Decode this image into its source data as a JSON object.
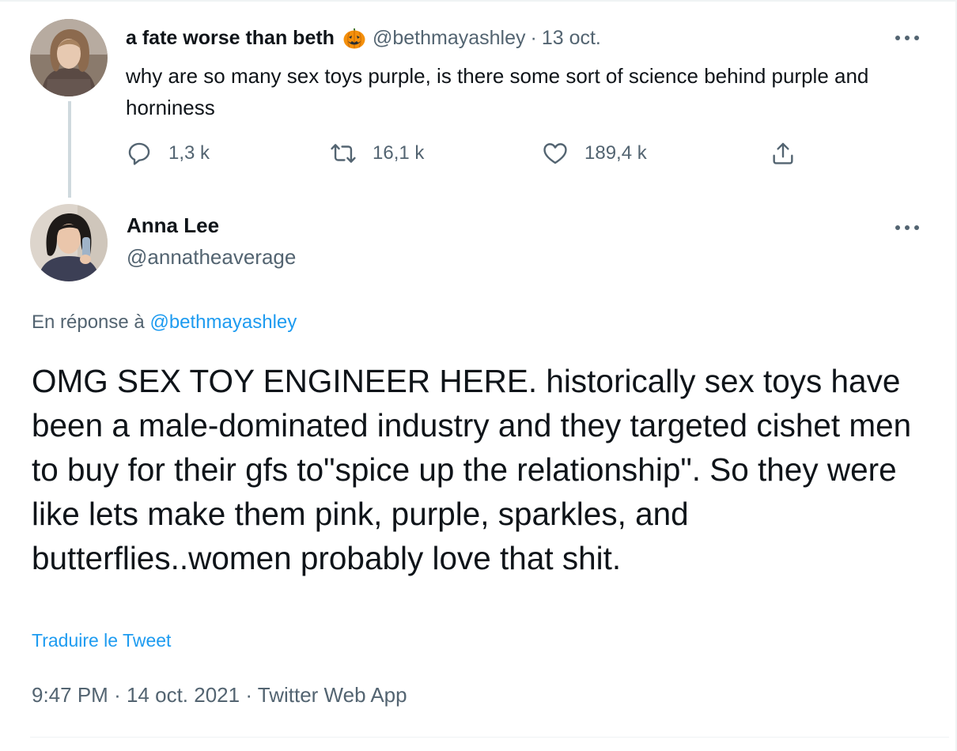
{
  "parent_tweet": {
    "display_name": "a fate worse than beth",
    "name_emoji": "pumpkin-emoji",
    "handle": "@bethmayashley",
    "separator": "·",
    "date": "13 oct.",
    "text": "why are so many sex toys purple, is there some sort of science behind purple and horniness",
    "actions": {
      "replies": "1,3 k",
      "retweets": "16,1 k",
      "likes": "189,4 k"
    }
  },
  "main_tweet": {
    "display_name": "Anna Lee",
    "handle": "@annatheaverage",
    "reply_to_label": "En réponse à",
    "reply_to_handle": "@bethmayashley",
    "text": "OMG SEX TOY ENGINEER HERE. historically sex toys have been a male-dominated industry and they targeted cishet men to buy for their gfs to\"spice up the relationship\". So they were like lets make them pink, purple, sparkles, and butterflies..women probably love that shit.",
    "translate_label": "Traduire le Tweet",
    "time": "9:47 PM",
    "separator": "·",
    "date": "14 oct. 2021",
    "source": "Twitter Web App"
  },
  "icons": [
    "reply-icon",
    "retweet-icon",
    "like-icon",
    "share-icon",
    "more-icon"
  ],
  "colors": {
    "text": "#0f1419",
    "secondary": "#536471",
    "link": "#1d9bf0",
    "border": "#eff3f4",
    "thread_line": "#cfd9de"
  }
}
